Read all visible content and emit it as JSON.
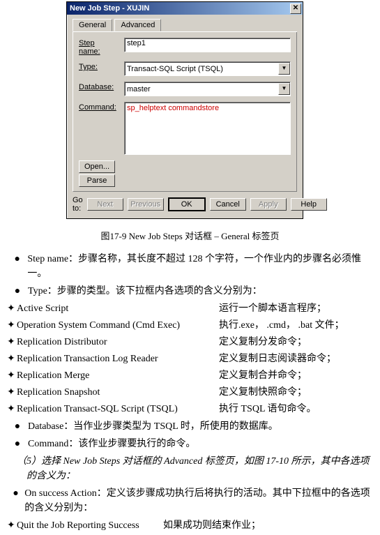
{
  "window": {
    "title": "New Job Step - XUJIN",
    "tabs": {
      "general": "General",
      "advanced": "Advanced"
    },
    "labels": {
      "step_name": "Step name:",
      "type": "Type:",
      "database": "Database:",
      "command": "Command:",
      "goto": "Go to:"
    },
    "values": {
      "step_name": "step1",
      "type": "Transact-SQL Script (TSQL)",
      "database": "master",
      "command": "sp_helptext  commandstore"
    },
    "buttons": {
      "open": "Open...",
      "parse": "Parse",
      "next": "Next",
      "previous": "Previous",
      "ok": "OK",
      "cancel": "Cancel",
      "apply": "Apply",
      "help": "Help"
    }
  },
  "caption": "图17-9  New Job Steps 对话框  – General 标签页",
  "bullets": {
    "step_name": "Step name：步骤名称，其长度不超过 128 个字符，一个作业内的步骤名必须惟一。",
    "type": "Type：步骤的类型。该下拉框内各选项的含义分别为：",
    "database": "Database：当作业步骤类型为 TSQL 时，所使用的数据库。",
    "command": "Command：该作业步骤要执行的命令。",
    "on_success": "On  success  Action：定义该步骤成功执行后将执行的活动。其中下拉框中的各选项的含义分别为："
  },
  "types": [
    {
      "name": "Active Script",
      "desc": "运行一个脚本语言程序；"
    },
    {
      "name": "Operation System Command (Cmd Exec)",
      "desc": "执行.exe，  .cmd，  .bat 文件；"
    },
    {
      "name": "Replication Distributor",
      "desc": "定义复制分发命令；"
    },
    {
      "name": "Replication Transaction Log Reader",
      "desc": "定义复制日志阅读器命令；"
    },
    {
      "name": "Replication Merge",
      "desc": "定义复制合并命令；"
    },
    {
      "name": "Replication Snapshot",
      "desc": "定义复制快照命令；"
    },
    {
      "name": "Replication Transact-SQL Script (TSQL)",
      "desc": "执行 TSQL 语句命令。"
    }
  ],
  "step5": "（5）选择 New  Job  Steps 对话框的 Advanced 标签页，如图 17-10 所示，其中各选项的含义为：",
  "quit": {
    "name": "Quit the Job Reporting Success",
    "desc": "如果成功则结束作业；"
  }
}
